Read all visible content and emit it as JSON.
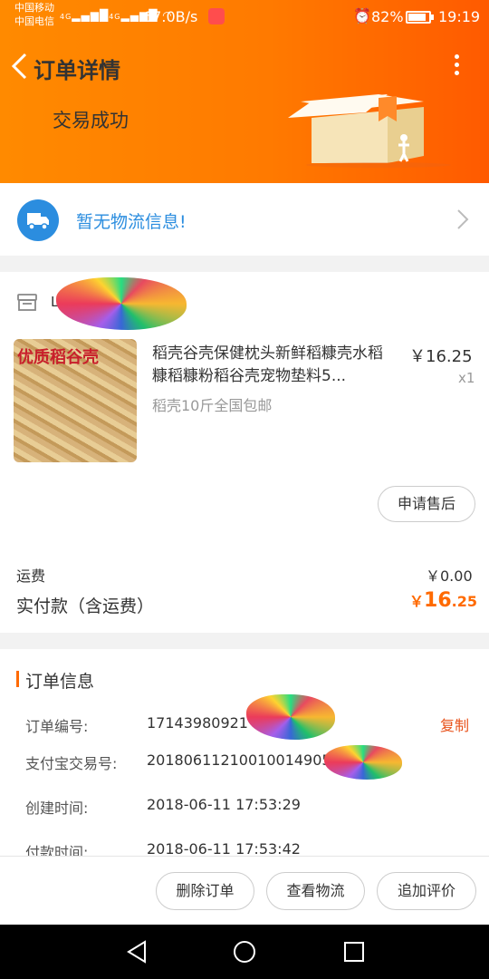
{
  "status_bar": {
    "carrier_1": "中国移动",
    "carrier_2": "中国电信",
    "signal_1": "4G",
    "signal_2": "4G",
    "net_speed": "67.0B/s",
    "battery": "82%",
    "time": "19:19"
  },
  "header": {
    "title": "订单详情",
    "trade_status": "交易成功"
  },
  "logistics": {
    "text": "暂无物流信息!"
  },
  "order": {
    "shop_name": "L",
    "product": {
      "image_label": "优质稻谷壳",
      "title": "稻壳谷壳保健枕头新鲜稻糠壳水稻糠稻糠粉稻谷壳宠物垫料5...",
      "price": "￥16.25",
      "quantity": "x1",
      "sku": "稻壳10斤全国包邮",
      "after_sale_button": "申请售后"
    },
    "shipping_label": "运费",
    "shipping_value": "￥0.00",
    "paid_label": "实付款（含运费）",
    "paid_currency": "￥",
    "paid_integer": "16",
    "paid_decimal": ".25"
  },
  "order_info": {
    "title": "订单信息",
    "copy_label": "复制",
    "rows": [
      {
        "label": "订单编号:",
        "value": "17143980921"
      },
      {
        "label": "支付宝交易号:",
        "value": "201806112100100149059"
      },
      {
        "label": "创建时间:",
        "value": "2018-06-11 17:53:29"
      },
      {
        "label": "付款时间:",
        "value": "2018-06-11 17:53:42"
      }
    ]
  },
  "actions": {
    "delete": "删除订单",
    "view_logistics": "查看物流",
    "add_review": "追加评价"
  },
  "colors": {
    "header_orange": "#ff7a00",
    "accent_orange": "#ff6a00",
    "link_blue": "#2b8ddf",
    "copy_red": "#e8521b"
  }
}
